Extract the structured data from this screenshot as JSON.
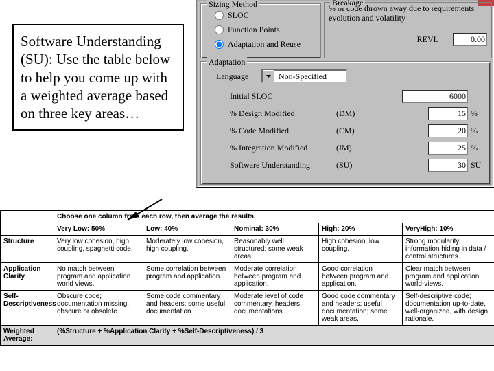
{
  "callout_text": "Software Understanding (SU): Use the table below to help you come up with a weighted average based on three key areas…",
  "sizing": {
    "legend": "Sizing Method",
    "opt_sloc": "SLOC",
    "opt_fp": "Function Points",
    "opt_ar": "Adaptation and Reuse"
  },
  "breakage": {
    "legend": "Breakage",
    "text": "% of code thrown away due to requirements evolution and volatility",
    "revl_label": "REVL",
    "revl_value": "0.00"
  },
  "adaptation": {
    "legend": "Adaptation",
    "language_label": "Language",
    "language_value": "Non-Specified",
    "initial_sloc_label": "Initial SLOC",
    "initial_sloc_value": "6000",
    "rows": [
      {
        "label": "% Design Modified",
        "paren": "(DM)",
        "value": "15",
        "unit": "%"
      },
      {
        "label": "% Code Modified",
        "paren": "(CM)",
        "value": "20",
        "unit": "%"
      },
      {
        "label": "% Integration Modified",
        "paren": "(IM)",
        "value": "25",
        "unit": "%"
      },
      {
        "label": "Software Understanding",
        "paren": "(SU)",
        "value": "30",
        "unit": "SU"
      }
    ]
  },
  "table": {
    "caption": "Choose one column from each row, then average the results.",
    "col_headers": [
      "",
      "Very Low: 50%",
      "Low: 40%",
      "Nominal: 30%",
      "High: 20%",
      "VeryHigh: 10%"
    ],
    "rows": [
      {
        "h": "Structure",
        "c": [
          "Very low cohesion, high coupling, spaghetti code.",
          "Moderately low cohesion, high coupling.",
          "Reasonably well structured; some weak areas.",
          "High cohesion, low coupling.",
          "Strong modularity, information hiding in data / control structures."
        ]
      },
      {
        "h": "Application Clarity",
        "c": [
          "No match between program and application world views.",
          "Some correlation between program and application.",
          "Moderate correlation between program and application.",
          "Good correlation between program and application.",
          "Clear match between program and application world-views."
        ]
      },
      {
        "h": "Self-Descriptiveness",
        "c": [
          "Obscure code; documentation missing, obscure or obsolete.",
          "Some code commentary and headers; some useful documentation.",
          "Moderate level of code commentary, headers, documentations.",
          "Good code commentary and headers; useful documentation; some weak areas.",
          "Self-descriptive code; documentation up-to-date, well-organized, with design rationale."
        ]
      }
    ],
    "formula_label": "Weighted Average:",
    "formula": "(%Structure + %Application Clarity + %Self-Descriptiveness) / 3"
  }
}
